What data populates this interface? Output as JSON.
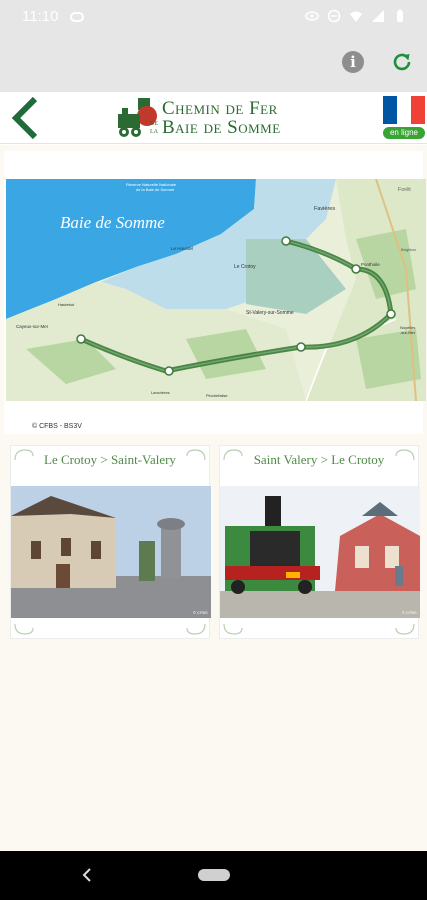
{
  "status_bar": {
    "time": "11:10"
  },
  "app_header": {
    "logo_line1": "Chemin de Fer",
    "logo_small_de": "DE",
    "logo_small_la": "LA",
    "logo_line2": "Baie de Somme",
    "online_badge": "en ligne",
    "flag_colors": [
      "#0055a4",
      "#ffffff",
      "#ef4135"
    ]
  },
  "map": {
    "bay_label": "Baie de Somme",
    "reserve_label_1": "Réserve Naturelle Nationale",
    "reserve_label_2": "de la Baie de Somme",
    "places": {
      "favieres": "Favières",
      "forest": "Forêt",
      "lehourdel": "Le Hourdel",
      "lecrotoy": "Le Crotoy",
      "ponthoile": "Ponthoile",
      "brighton": "Brighton",
      "stvalery": "St-Valery-sur-Somme",
      "noyelles_1": "Noyelles",
      "noyelles_2": "-sur-Mer",
      "cayeux": "Cayeux-sur-Mer",
      "lanchere": "Lanchères",
      "pinchefalise": "Pinchefalise",
      "hautebut": "Hautebut"
    },
    "copyright": "© CFBS  -  BS3V"
  },
  "routes": [
    {
      "title": "Le Crotoy > Saint-Valery"
    },
    {
      "title": "Saint Valery > Le Crotoy"
    }
  ],
  "photo_credit": "© CFBS",
  "colors": {
    "brand_green": "#2b6b33",
    "route_green": "#4f8a46",
    "content_bg": "#fbf9f2",
    "sea": "#3aa6e4"
  }
}
